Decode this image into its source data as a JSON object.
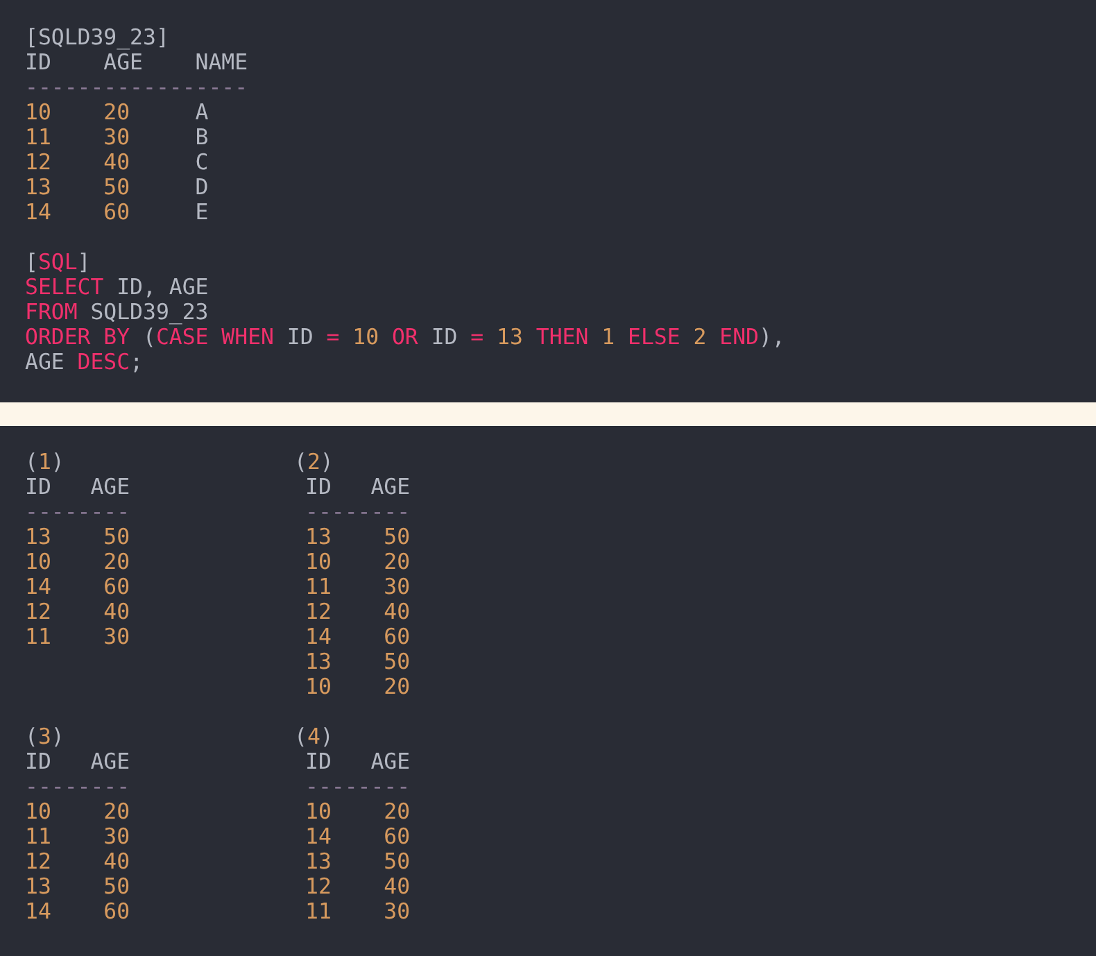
{
  "source_table": {
    "title": "[SQLD39_23]",
    "columns": [
      "ID",
      "AGE",
      "NAME"
    ],
    "separator": "-----------------",
    "rows": [
      [
        "10",
        "20",
        "A"
      ],
      [
        "11",
        "30",
        "B"
      ],
      [
        "12",
        "40",
        "C"
      ],
      [
        "13",
        "50",
        "D"
      ],
      [
        "14",
        "60",
        "E"
      ]
    ]
  },
  "sql": {
    "lines": [
      [
        {
          "kind": "plain",
          "text": "["
        },
        {
          "kind": "keyword",
          "text": "SQL"
        },
        {
          "kind": "plain",
          "text": "]"
        }
      ],
      [
        {
          "kind": "keyword",
          "text": "SELECT"
        },
        {
          "kind": "plain",
          "text": " ID, AGE"
        }
      ],
      [
        {
          "kind": "keyword",
          "text": "FROM"
        },
        {
          "kind": "plain",
          "text": " SQLD39_23"
        }
      ],
      [
        {
          "kind": "keyword",
          "text": "ORDER BY"
        },
        {
          "kind": "plain",
          "text": " ("
        },
        {
          "kind": "keyword",
          "text": "CASE WHEN"
        },
        {
          "kind": "plain",
          "text": " ID "
        },
        {
          "kind": "keyword",
          "text": "= "
        },
        {
          "kind": "number",
          "text": "10 "
        },
        {
          "kind": "keyword",
          "text": "OR"
        },
        {
          "kind": "plain",
          "text": " ID "
        },
        {
          "kind": "keyword",
          "text": "= "
        },
        {
          "kind": "number",
          "text": "13 "
        },
        {
          "kind": "keyword",
          "text": "THEN "
        },
        {
          "kind": "number",
          "text": "1 "
        },
        {
          "kind": "keyword",
          "text": "ELSE "
        },
        {
          "kind": "number",
          "text": "2 "
        },
        {
          "kind": "keyword",
          "text": "END"
        },
        {
          "kind": "plain",
          "text": "),"
        }
      ],
      [
        {
          "kind": "plain",
          "text": "AGE "
        },
        {
          "kind": "keyword",
          "text": "DESC"
        },
        {
          "kind": "plain",
          "text": ";"
        }
      ]
    ]
  },
  "options": [
    {
      "label": [
        {
          "kind": "plain",
          "text": "("
        },
        {
          "kind": "number",
          "text": "1"
        },
        {
          "kind": "plain",
          "text": ")"
        }
      ],
      "columns": [
        "ID",
        "AGE"
      ],
      "separator": "--------",
      "rows": [
        [
          "13",
          "50"
        ],
        [
          "10",
          "20"
        ],
        [
          "14",
          "60"
        ],
        [
          "12",
          "40"
        ],
        [
          "11",
          "30"
        ]
      ]
    },
    {
      "label": [
        {
          "kind": "plain",
          "text": "("
        },
        {
          "kind": "number",
          "text": "2"
        },
        {
          "kind": "plain",
          "text": ")"
        }
      ],
      "columns": [
        "ID",
        "AGE"
      ],
      "separator": "--------",
      "rows": [
        [
          "13",
          "50"
        ],
        [
          "10",
          "20"
        ],
        [
          "11",
          "30"
        ],
        [
          "12",
          "40"
        ],
        [
          "14",
          "60"
        ],
        [
          "13",
          "50"
        ],
        [
          "10",
          "20"
        ]
      ]
    },
    {
      "label": [
        {
          "kind": "plain",
          "text": "("
        },
        {
          "kind": "number",
          "text": "3"
        },
        {
          "kind": "plain",
          "text": ")"
        }
      ],
      "columns": [
        "ID",
        "AGE"
      ],
      "separator": "--------",
      "rows": [
        [
          "10",
          "20"
        ],
        [
          "11",
          "30"
        ],
        [
          "12",
          "40"
        ],
        [
          "13",
          "50"
        ],
        [
          "14",
          "60"
        ]
      ]
    },
    {
      "label": [
        {
          "kind": "plain",
          "text": "("
        },
        {
          "kind": "number",
          "text": "4"
        },
        {
          "kind": "plain",
          "text": ")"
        }
      ],
      "columns": [
        "ID",
        "AGE"
      ],
      "separator": "--------",
      "rows": [
        [
          "10",
          "20"
        ],
        [
          "14",
          "60"
        ],
        [
          "13",
          "50"
        ],
        [
          "12",
          "40"
        ],
        [
          "11",
          "30"
        ]
      ]
    }
  ]
}
